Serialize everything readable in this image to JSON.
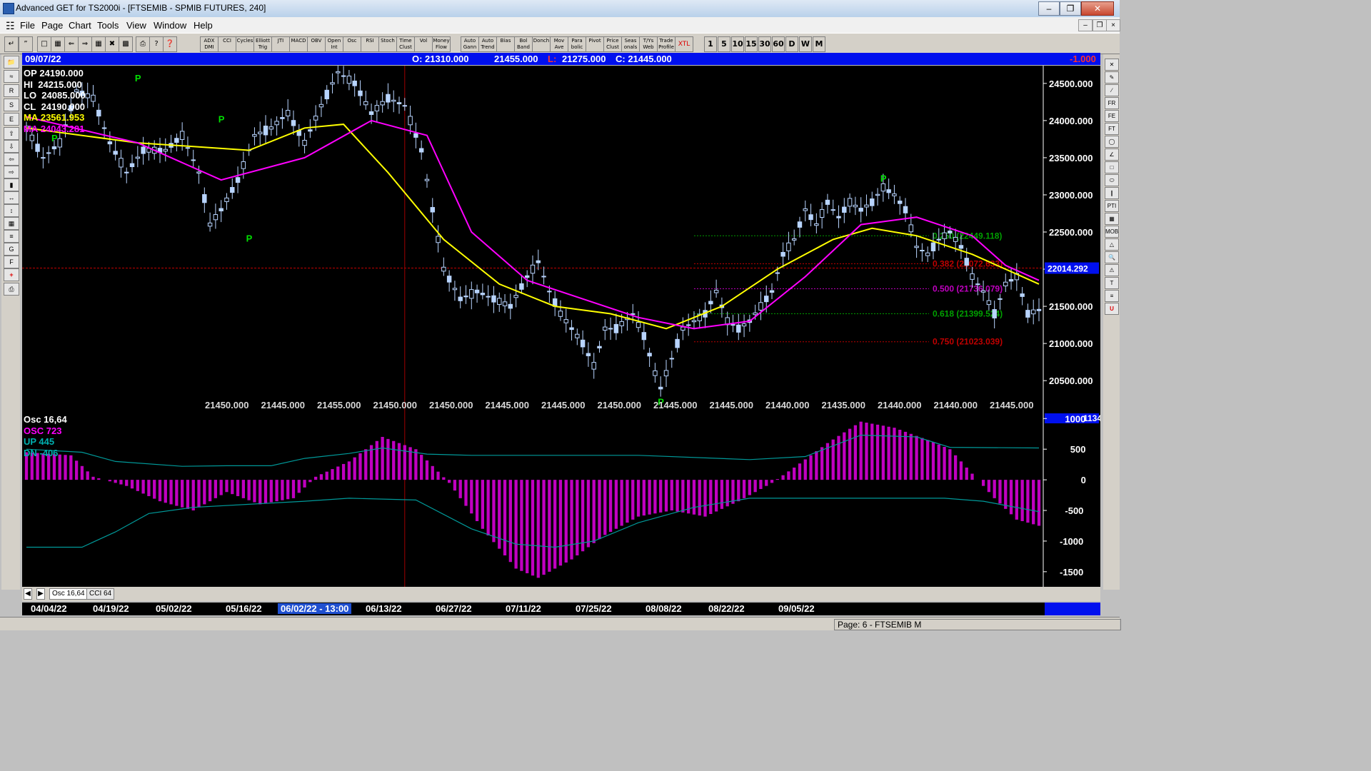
{
  "window": {
    "title": "Advanced GET for TS2000i - [FTSEMIB - SPMIB FUTURES, 240]"
  },
  "menu": [
    "File",
    "Page",
    "Chart",
    "Tools",
    "View",
    "Window",
    "Help"
  ],
  "toolbar": {
    "indicators": [
      "ADX DMI",
      "CCI",
      "Cycles",
      "Elliott Trig",
      "JTI",
      "MACD",
      "OBV",
      "Open Int",
      "Osc",
      "RSI",
      "Stoch",
      "Time Clust",
      "Vol",
      "Money Flow",
      "Auto Gann",
      "Auto Trend",
      "Bias",
      "Bol Band",
      "Donch",
      "Mov Ave",
      "Para bolic",
      "Pivot",
      "Price Clust",
      "Seas onals",
      "T/Ys Web",
      "Trade Profile",
      "XTL"
    ],
    "timeframes": [
      "1",
      "5",
      "10",
      "15",
      "30",
      "60",
      "D",
      "W",
      "M"
    ]
  },
  "infobar": {
    "date": "09/07/22",
    "open": "O: 21310.000",
    "high": "21455.000",
    "low_label": "L:",
    "low": "21275.000",
    "close": "C: 21445.000",
    "change": "-1.000"
  },
  "price_legend": [
    {
      "label": "OP",
      "value": "24190.000",
      "color": "#ffffff"
    },
    {
      "label": "HI",
      "value": "24215.000",
      "color": "#ffffff"
    },
    {
      "label": "LO",
      "value": "24085.000",
      "color": "#ffffff"
    },
    {
      "label": "CL",
      "value": "24190.000",
      "color": "#ffffff"
    },
    {
      "label": "MA",
      "value": "23561.953",
      "color": "#ffff00"
    },
    {
      "label": "MA",
      "value": "24043.281",
      "color": "#ff00ff"
    }
  ],
  "osc_legend": [
    {
      "text": "Osc 16,64",
      "color": "#ffffff"
    },
    {
      "text": "OSC 723",
      "color": "#ff00ff"
    },
    {
      "text": "UP  445",
      "color": "#00b0b0"
    },
    {
      "text": "DN  -406",
      "color": "#00b0b0"
    }
  ],
  "cursor_price": "22014.292",
  "osc_cursor_value": "1134",
  "bottom_price_row": [
    "21450.000",
    "21445.000",
    "21455.000",
    "21450.000",
    "21450.000",
    "21445.000",
    "21445.000",
    "21450.000",
    "21445.000",
    "21445.000",
    "21440.000",
    "21435.000",
    "21440.000",
    "21440.000",
    "21445.000"
  ],
  "cursor_date": "06/02/22 - 13:00",
  "dates": [
    "04/04/22",
    "04/19/22",
    "05/02/22",
    "05/16/22",
    "06/13/22",
    "06/27/22",
    "07/11/22",
    "07/25/22",
    "08/08/22",
    "08/22/22",
    "09/05/22"
  ],
  "tabs": [
    "Osc 16,64",
    "CCI 64"
  ],
  "status": "Page: 6 - FTSEMIB M",
  "colors": {
    "candle": "#b8d4ff",
    "ma_fast": "#ffff00",
    "ma_slow": "#ff00ff",
    "osc_hist": "#c000c0",
    "osc_band": "#009999",
    "info_bar": "#0010ee"
  },
  "chart_data": {
    "type": "candlestick",
    "instrument": "FTSEMIB - SPMIB FUTURES",
    "timeframe": "240",
    "price_axis_ticks": [
      24500,
      24000,
      23500,
      23000,
      22500,
      22000,
      21500,
      21000,
      20500
    ],
    "price_axis_labels": [
      "24500.000",
      "24000.000",
      "23500.000",
      "23000.000",
      "22500.000",
      "22000.000",
      "21500.000",
      "21000.000",
      "20500.000"
    ],
    "ylim": [
      20300,
      24700
    ],
    "price_path": [
      [
        0,
        23900
      ],
      [
        3,
        23500
      ],
      [
        6,
        23700
      ],
      [
        9,
        24400
      ],
      [
        12,
        24300
      ],
      [
        15,
        23700
      ],
      [
        18,
        23300
      ],
      [
        21,
        23600
      ],
      [
        25,
        23600
      ],
      [
        28,
        23800
      ],
      [
        31,
        23300
      ],
      [
        33,
        22600
      ],
      [
        35,
        22800
      ],
      [
        38,
        23200
      ],
      [
        41,
        23800
      ],
      [
        44,
        23900
      ],
      [
        47,
        24100
      ],
      [
        50,
        23700
      ],
      [
        53,
        24200
      ],
      [
        56,
        24650
      ],
      [
        59,
        24500
      ],
      [
        62,
        24100
      ],
      [
        65,
        24300
      ],
      [
        68,
        24200
      ],
      [
        71,
        23600
      ],
      [
        73,
        22800
      ],
      [
        75,
        22000
      ],
      [
        78,
        21600
      ],
      [
        81,
        21700
      ],
      [
        84,
        21600
      ],
      [
        87,
        21500
      ],
      [
        90,
        21900
      ],
      [
        92,
        22100
      ],
      [
        94,
        21700
      ],
      [
        96,
        21400
      ],
      [
        98,
        21200
      ],
      [
        100,
        21000
      ],
      [
        102,
        20700
      ],
      [
        104,
        21200
      ],
      [
        106,
        21200
      ],
      [
        109,
        21400
      ],
      [
        111,
        21100
      ],
      [
        113,
        20600
      ],
      [
        114,
        20400
      ],
      [
        116,
        20800
      ],
      [
        118,
        21200
      ],
      [
        120,
        21300
      ],
      [
        122,
        21400
      ],
      [
        124,
        21700
      ],
      [
        126,
        21300
      ],
      [
        128,
        21200
      ],
      [
        130,
        21300
      ],
      [
        132,
        21500
      ],
      [
        134,
        21700
      ],
      [
        136,
        22200
      ],
      [
        138,
        22400
      ],
      [
        140,
        22800
      ],
      [
        142,
        22600
      ],
      [
        144,
        22900
      ],
      [
        146,
        22700
      ],
      [
        148,
        22900
      ],
      [
        150,
        22800
      ],
      [
        152,
        22900
      ],
      [
        154,
        23100
      ],
      [
        156,
        23000
      ],
      [
        158,
        22800
      ],
      [
        160,
        22300
      ],
      [
        162,
        22200
      ],
      [
        164,
        22400
      ],
      [
        166,
        22500
      ],
      [
        168,
        22300
      ],
      [
        170,
        21900
      ],
      [
        172,
        21700
      ],
      [
        174,
        21400
      ],
      [
        176,
        21800
      ],
      [
        178,
        21900
      ],
      [
        180,
        21400
      ],
      [
        182,
        21450
      ]
    ],
    "ma_fast": [
      [
        0,
        23900
      ],
      [
        20,
        23700
      ],
      [
        40,
        23600
      ],
      [
        50,
        23900
      ],
      [
        57,
        23950
      ],
      [
        65,
        23300
      ],
      [
        75,
        22400
      ],
      [
        85,
        21800
      ],
      [
        95,
        21500
      ],
      [
        105,
        21400
      ],
      [
        115,
        21200
      ],
      [
        125,
        21500
      ],
      [
        135,
        22000
      ],
      [
        145,
        22400
      ],
      [
        152,
        22550
      ],
      [
        160,
        22450
      ],
      [
        170,
        22200
      ],
      [
        182,
        21800
      ]
    ],
    "ma_slow": [
      [
        0,
        24050
      ],
      [
        20,
        23700
      ],
      [
        35,
        23200
      ],
      [
        50,
        23500
      ],
      [
        62,
        24000
      ],
      [
        72,
        23800
      ],
      [
        80,
        22500
      ],
      [
        90,
        21850
      ],
      [
        100,
        21600
      ],
      [
        110,
        21350
      ],
      [
        120,
        21200
      ],
      [
        130,
        21300
      ],
      [
        140,
        21900
      ],
      [
        150,
        22600
      ],
      [
        160,
        22700
      ],
      [
        170,
        22450
      ],
      [
        176,
        22050
      ],
      [
        182,
        21850
      ]
    ],
    "pivots": [
      {
        "label": "P",
        "idx": 5,
        "price": 23950,
        "pos": "below"
      },
      {
        "label": "P",
        "idx": 20,
        "price": 24450,
        "pos": "above"
      },
      {
        "label": "P",
        "idx": 35,
        "price": 23900,
        "pos": "above"
      },
      {
        "label": "P",
        "idx": 40,
        "price": 22600,
        "pos": "below"
      },
      {
        "label": "P",
        "idx": 114,
        "price": 20400,
        "pos": "below"
      },
      {
        "label": "P",
        "idx": 154,
        "price": 23100,
        "pos": "above"
      }
    ],
    "fib_levels": [
      {
        "ratio": "0.250",
        "value": "22449.118",
        "price": 22449.118,
        "color": "#00a000",
        "label": "0.250 (22449.118)"
      },
      {
        "ratio": "0.382",
        "value": "22072.633",
        "price": 22072.633,
        "color": "#c00000",
        "label": "0.382 (22072.633)"
      },
      {
        "ratio": "0.500",
        "value": "21736.079",
        "price": 21736.079,
        "color": "#c000c0",
        "label": "0.500 (21736.079)"
      },
      {
        "ratio": "0.618",
        "value": "21399.524",
        "price": 21399.524,
        "color": "#00a000",
        "label": "0.618 (21399.524)"
      },
      {
        "ratio": "0.750",
        "value": "21023.039",
        "price": 21023.039,
        "color": "#c00000",
        "label": "0.750 (21023.039)"
      }
    ],
    "fib_start_idx": 120,
    "cursor_line_price": 22014.292,
    "cursor_line_idx": 68,
    "osc_axis_ticks": [
      1000,
      500,
      0,
      -500,
      -1000,
      -1500
    ],
    "osc_axis_labels": [
      "1000",
      "500",
      "0",
      "-500",
      "-1000",
      "-1500"
    ],
    "osc_ylim": [
      -1700,
      1050
    ],
    "osc_path": [
      [
        0,
        450
      ],
      [
        8,
        400
      ],
      [
        12,
        50
      ],
      [
        18,
        -100
      ],
      [
        24,
        -350
      ],
      [
        30,
        -500
      ],
      [
        36,
        -200
      ],
      [
        42,
        -400
      ],
      [
        48,
        -300
      ],
      [
        52,
        50
      ],
      [
        58,
        300
      ],
      [
        64,
        700
      ],
      [
        70,
        500
      ],
      [
        76,
        -50
      ],
      [
        82,
        -800
      ],
      [
        88,
        -1450
      ],
      [
        92,
        -1600
      ],
      [
        98,
        -1300
      ],
      [
        104,
        -900
      ],
      [
        110,
        -600
      ],
      [
        116,
        -500
      ],
      [
        122,
        -600
      ],
      [
        128,
        -350
      ],
      [
        134,
        -50
      ],
      [
        138,
        200
      ],
      [
        144,
        600
      ],
      [
        150,
        950
      ],
      [
        156,
        850
      ],
      [
        162,
        650
      ],
      [
        166,
        500
      ],
      [
        170,
        100
      ],
      [
        174,
        -300
      ],
      [
        178,
        -650
      ],
      [
        182,
        -750
      ]
    ],
    "osc_up_band": [
      [
        0,
        500
      ],
      [
        10,
        450
      ],
      [
        16,
        300
      ],
      [
        28,
        220
      ],
      [
        36,
        230
      ],
      [
        44,
        230
      ],
      [
        50,
        350
      ],
      [
        58,
        430
      ],
      [
        64,
        520
      ],
      [
        72,
        420
      ],
      [
        80,
        400
      ],
      [
        95,
        400
      ],
      [
        110,
        400
      ],
      [
        130,
        330
      ],
      [
        140,
        380
      ],
      [
        150,
        730
      ],
      [
        160,
        700
      ],
      [
        166,
        530
      ],
      [
        182,
        520
      ]
    ],
    "osc_dn_band": [
      [
        0,
        -1100
      ],
      [
        10,
        -1100
      ],
      [
        16,
        -850
      ],
      [
        22,
        -550
      ],
      [
        30,
        -450
      ],
      [
        40,
        -400
      ],
      [
        50,
        -350
      ],
      [
        58,
        -300
      ],
      [
        70,
        -330
      ],
      [
        80,
        -800
      ],
      [
        88,
        -1050
      ],
      [
        95,
        -1100
      ],
      [
        102,
        -1000
      ],
      [
        110,
        -700
      ],
      [
        120,
        -450
      ],
      [
        130,
        -300
      ],
      [
        140,
        -300
      ],
      [
        155,
        -300
      ],
      [
        165,
        -300
      ],
      [
        172,
        -350
      ],
      [
        182,
        -520
      ]
    ],
    "n_bars": 183
  }
}
